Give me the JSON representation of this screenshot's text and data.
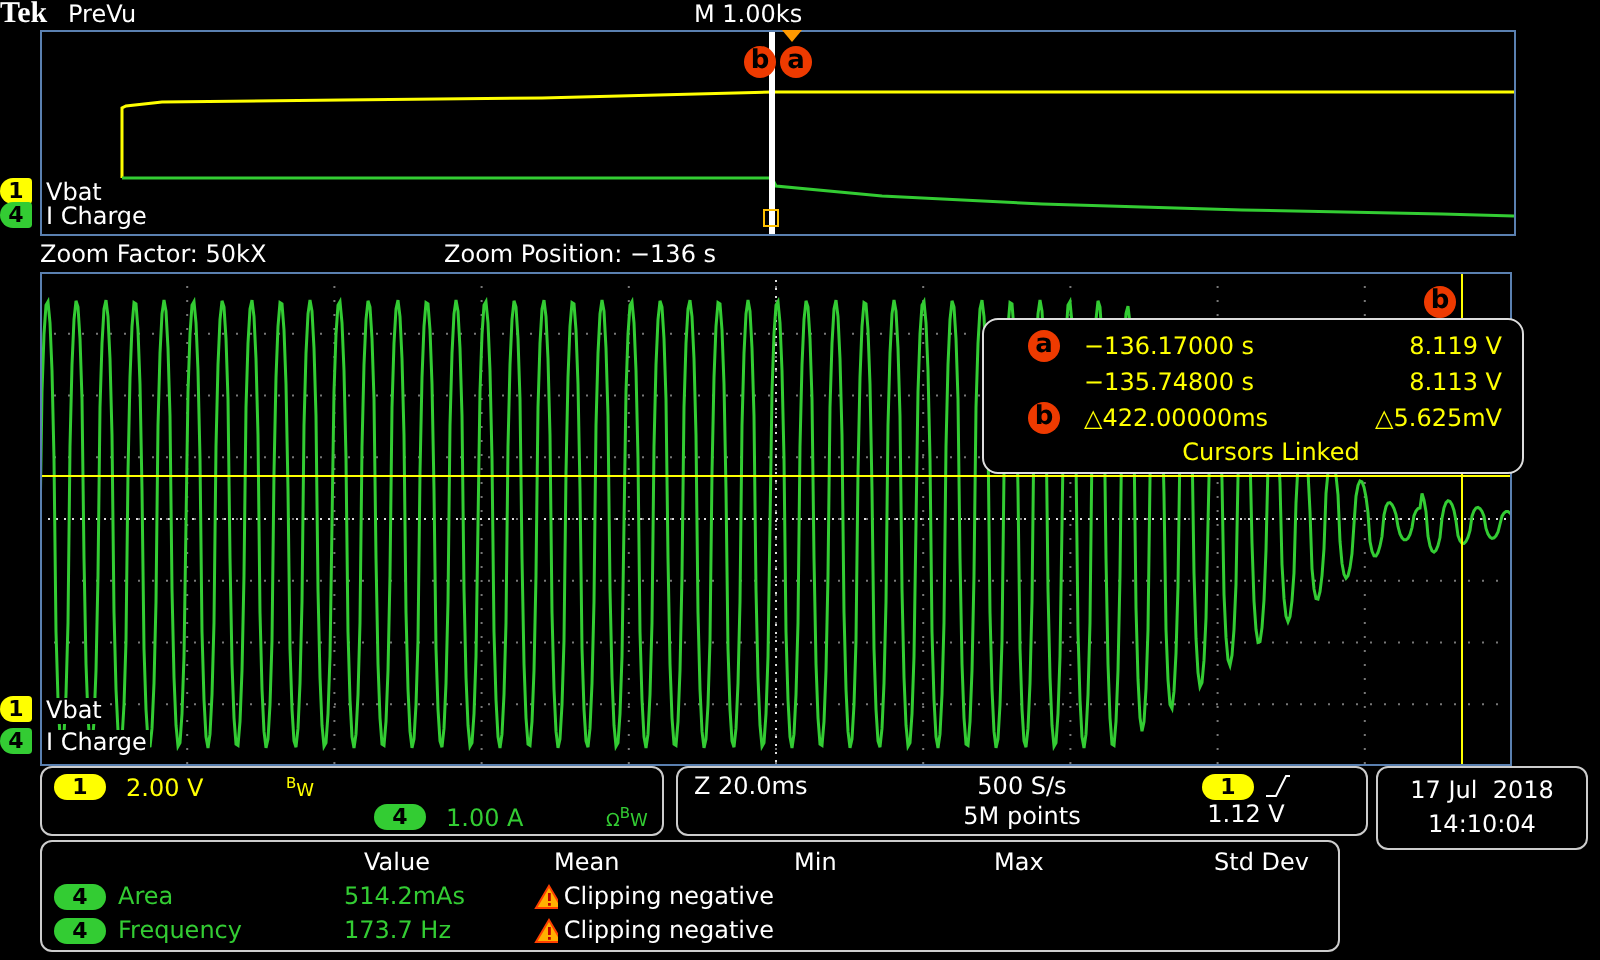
{
  "header": {
    "brand": "Tek",
    "mode": "PreVu",
    "timebase": "M 1.00ks"
  },
  "overview": {
    "cursor_labels": [
      "b",
      "a"
    ],
    "channels": [
      {
        "number": "1",
        "name": "Vbat",
        "color": "#ffff00"
      },
      {
        "number": "4",
        "name": "I Charge",
        "color": "#33cc33"
      }
    ]
  },
  "zoom": {
    "factor": "Zoom Factor: 50kX",
    "position": "Zoom Position: −136 s"
  },
  "main": {
    "cursor_label": "b",
    "channels": [
      {
        "number": "1",
        "name": "Vbat",
        "color": "#ffff00"
      },
      {
        "number": "4",
        "name": "I Charge",
        "color": "#33cc33"
      }
    ],
    "readout": {
      "rows": [
        {
          "marker": "a",
          "time": "−136.17000 s",
          "value": "8.119 V"
        },
        {
          "time": "−135.74800 s",
          "value": "8.113 V"
        },
        {
          "marker": "b",
          "time": "△422.00000ms",
          "value": "△5.625mV"
        }
      ],
      "footer": "Cursors Linked"
    }
  },
  "channel_settings": [
    {
      "number": "1",
      "scale": "2.00 V",
      "flags": "$^{B}$W",
      "color": "#ffff00"
    },
    {
      "number": "4",
      "scale": "1.00 A",
      "flags": "Ω$^{B}$W",
      "color": "#33cc33"
    }
  ],
  "acquisition": {
    "zoom_scale": "Z 20.0ms",
    "sample_rate": "500 S/s",
    "record_length": "5M points",
    "trigger_source": "1",
    "trigger_level": "1.12 V"
  },
  "measurements": {
    "columns": [
      "Value",
      "Mean",
      "Min",
      "Max",
      "Std Dev"
    ],
    "rows": [
      {
        "source": "4",
        "name": "Area",
        "value": "514.2mAs",
        "mean": "Clipping negative",
        "warning": true
      },
      {
        "source": "4",
        "name": "Frequency",
        "value": "173.7 Hz",
        "mean": "Clipping negative",
        "warning": true
      }
    ]
  },
  "datetime": {
    "date": "17 Jul  2018",
    "time": "14:10:04"
  }
}
